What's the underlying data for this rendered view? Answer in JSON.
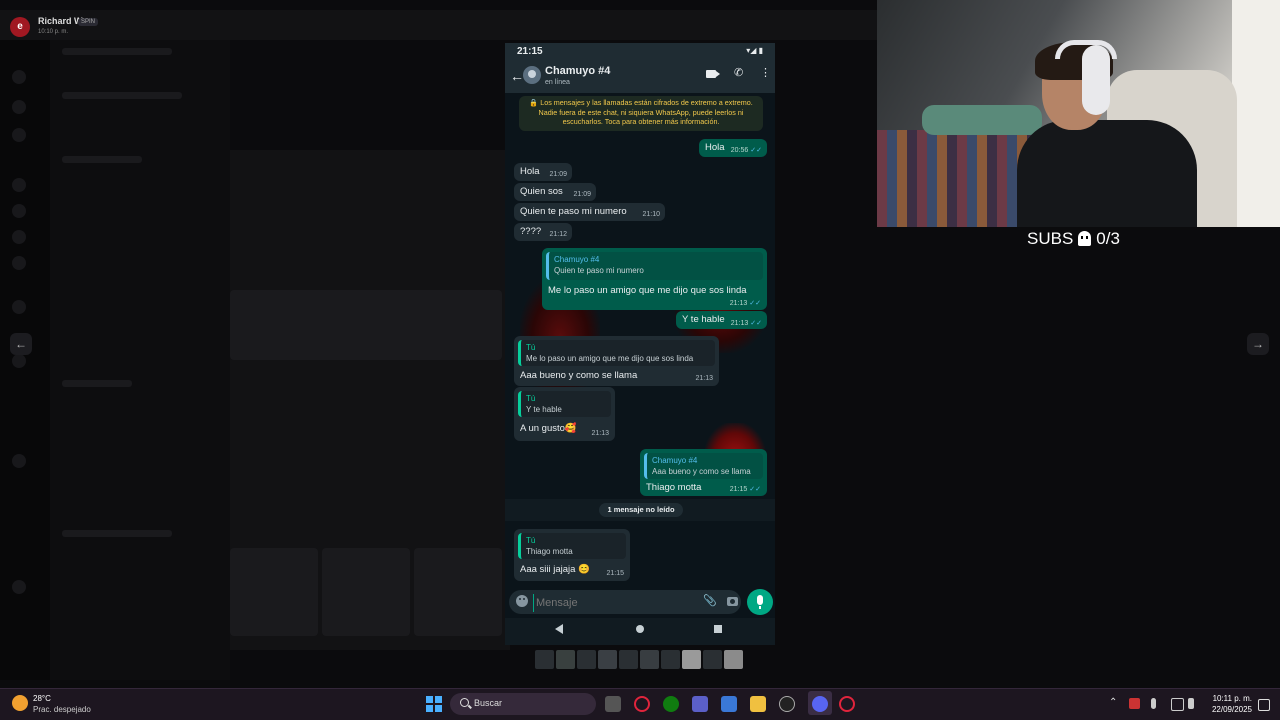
{
  "viewer": {
    "user_name": "Richard W.",
    "user_badge": "SPIN",
    "user_time": "10:10 p. m.",
    "avatar_letter": "e"
  },
  "phone": {
    "status_time": "21:15",
    "status_icons": "▾◢ ▮",
    "contact_name": "Chamuyo #4",
    "contact_status": "en línea",
    "encryption_notice": "🔒 Los mensajes y las llamadas están cifrados de extremo a extremo. Nadie fuera de este chat, ni siquiera WhatsApp, puede leerlos ni escucharlos. Toca para obtener más información.",
    "messages": [
      {
        "text": "Hola",
        "time": "20:56"
      },
      {
        "text": "Hola",
        "time": "21:09"
      },
      {
        "text": "Quien sos",
        "time": "21:09"
      },
      {
        "text": "Quien te paso mi numero",
        "time": "21:10"
      },
      {
        "text": "????",
        "time": "21:12"
      },
      {
        "quote_name": "Chamuyo #4",
        "quote_text": "Quien te paso mi numero",
        "text": "Me lo paso un amigo que me dijo que sos linda",
        "time": "21:13"
      },
      {
        "text": "Y te hable",
        "time": "21:13"
      },
      {
        "quote_name": "Tú",
        "quote_text": "Me lo paso un amigo que me dijo que sos linda",
        "text": "Aaa bueno y como se llama",
        "time": "21:13"
      },
      {
        "quote_name": "Tú",
        "quote_text": "Y te hable",
        "text": "A un gusto🥰",
        "time": "21:13"
      },
      {
        "quote_name": "Chamuyo #4",
        "quote_text": "Aaa bueno y como se llama",
        "text": "Thiago motta",
        "time": "21:15"
      },
      {
        "quote_name": "Tú",
        "quote_text": "Thiago motta",
        "text": "Aaa siii jajaja 😊",
        "time": "21:15"
      }
    ],
    "unread_label": "1 mensaje no leído",
    "input_placeholder": "Mensaje"
  },
  "stream": {
    "subs_text": "SUBS",
    "subs_count": "0/3"
  },
  "taskbar": {
    "weather_temp": "28°C",
    "weather_desc": "Prac. despejado",
    "search_text": "Buscar",
    "clock_time": "10:11 p. m.",
    "clock_date": "22/09/2025"
  },
  "colors": {
    "wa_bg": "#0b141a",
    "wa_out": "#005c4b",
    "wa_in": "#202c33",
    "wa_accent": "#00a884"
  }
}
